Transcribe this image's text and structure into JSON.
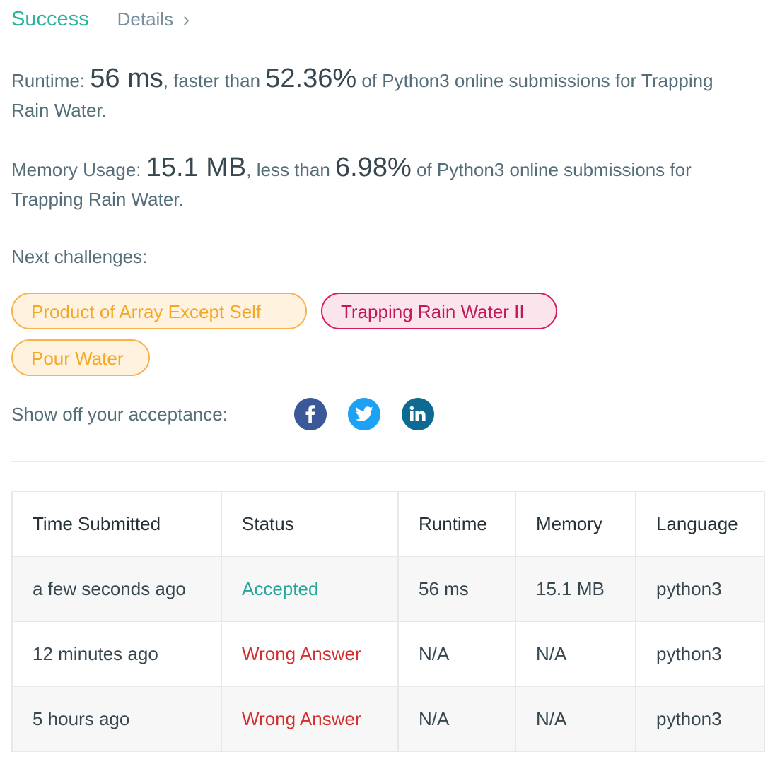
{
  "header": {
    "status": "Success",
    "details_label": "Details",
    "details_chevron": "›"
  },
  "runtime_stat": {
    "prefix": "Runtime: ",
    "value": "56 ms",
    "middle": ", faster than ",
    "percent": "52.36%",
    "suffix": " of Python3 online submissions for Trapping Rain Water."
  },
  "memory_stat": {
    "prefix": "Memory Usage: ",
    "value": "15.1 MB",
    "middle": ", less than ",
    "percent": "6.98%",
    "suffix": " of Python3 online submissions for Trapping Rain Water."
  },
  "next_challenges": {
    "label": "Next challenges:",
    "items": [
      {
        "label": "Product of Array Except Self",
        "difficulty_color": "orange"
      },
      {
        "label": "Trapping Rain Water II",
        "difficulty_color": "pink"
      },
      {
        "label": "Pour Water",
        "difficulty_color": "orange"
      }
    ]
  },
  "share": {
    "label": "Show off your acceptance:",
    "icons": [
      "facebook-icon",
      "twitter-icon",
      "linkedin-icon"
    ]
  },
  "table": {
    "headers": [
      "Time Submitted",
      "Status",
      "Runtime",
      "Memory",
      "Language"
    ],
    "rows": [
      {
        "time": "a few seconds ago",
        "status": "Accepted",
        "runtime": "56 ms",
        "memory": "15.1 MB",
        "language": "python3"
      },
      {
        "time": "12 minutes ago",
        "status": "Wrong Answer",
        "runtime": "N/A",
        "memory": "N/A",
        "language": "python3"
      },
      {
        "time": "5 hours ago",
        "status": "Wrong Answer",
        "runtime": "N/A",
        "memory": "N/A",
        "language": "python3"
      }
    ]
  },
  "colors": {
    "success": "#2db39a",
    "accepted": "#26a69a",
    "wrong_answer": "#d32f2f",
    "facebook": "#3b5998",
    "twitter": "#1da1f2",
    "linkedin": "#0e6a93",
    "pill_orange": "#f5a623",
    "pill_pink": "#c2185b"
  }
}
